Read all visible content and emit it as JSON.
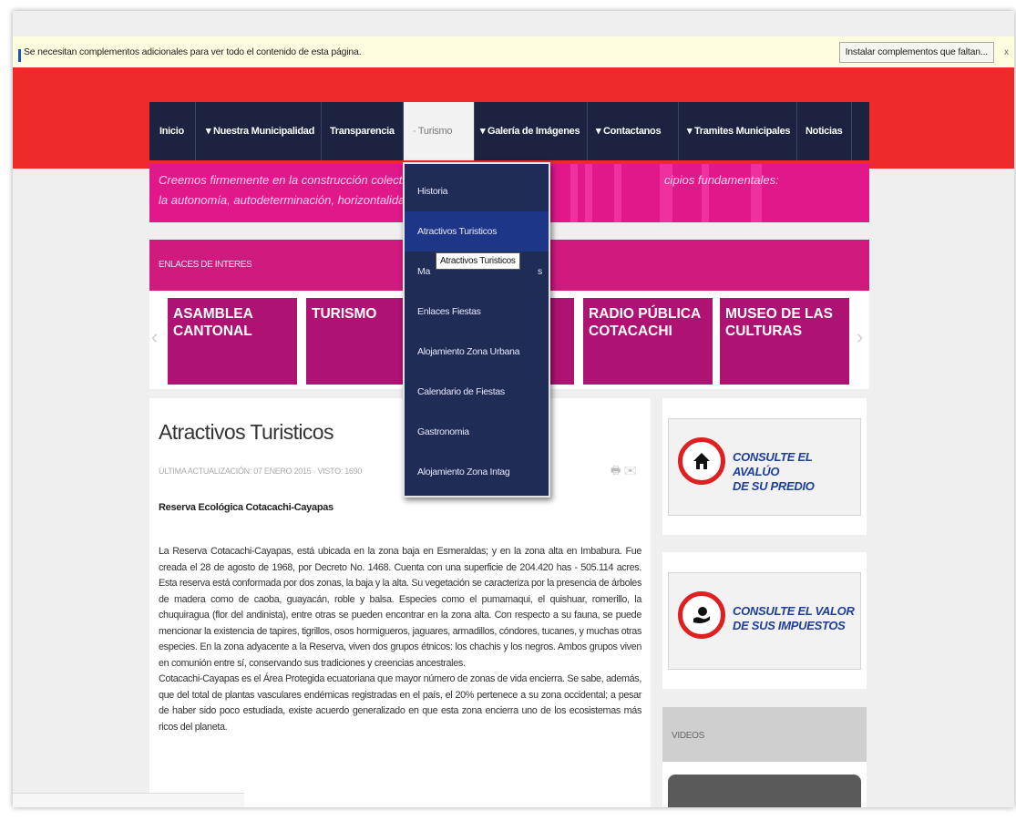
{
  "infobar": {
    "message": "Se necesitan complementos adicionales para ver todo el contenido de esta página.",
    "install_button": "Instalar complementos que faltan...",
    "close": "x"
  },
  "nav": {
    "items": [
      {
        "label": "Inicio"
      },
      {
        "label": "▾ Nuestra Municipalidad"
      },
      {
        "label": "Transparencia"
      },
      {
        "label": "· Turismo"
      },
      {
        "label": "▾ Galería de Imágenes"
      },
      {
        "label": "▾ Contactanos"
      },
      {
        "label": "▾ Tramites Municipales"
      },
      {
        "label": "Noticias"
      }
    ]
  },
  "banner": {
    "line1": "Creemos firmemente en la construcción colectiva",
    "line2": "la autonomía, autodeterminación, horizontalidad",
    "line3": "cipios fundamentales:"
  },
  "links": {
    "heading": "ENLACES DE INTERES",
    "tiles": [
      {
        "label": "ASAMBLEA\nCANTONAL"
      },
      {
        "label": "TURISMO"
      },
      {
        "label": "RADIO PÚBLICA\nCOTACACHI"
      },
      {
        "label": "MUSEO DE LAS\nCULTURAS"
      }
    ],
    "prev": "‹",
    "next": "›"
  },
  "dropdown": {
    "items": [
      {
        "label": "Historia"
      },
      {
        "label": "Atractivos Turisticos"
      },
      {
        "label": "Ma"
      },
      {
        "label": "Enlaces Fiestas"
      },
      {
        "label": "Alojamiento Zona Urbana"
      },
      {
        "label": "Calendario de Fiestas"
      },
      {
        "label": "Gastronomia"
      },
      {
        "label": "Alojamiento Zona Intag"
      }
    ],
    "tooltip": "Atractivos Turisticos",
    "tail": "s"
  },
  "article": {
    "title": "Atractivos Turisticos",
    "meta": "ÚLTIMA ACTUALIZACIÓN: 07 ENERO 2015 · VISTO: 1690",
    "tools": "🖶 ✉",
    "subtitle": "Reserva Ecológica Cotacachi-Cayapas",
    "p1": "La Reserva Cotacachi-Cayapas, está ubicada en la zona baja en Esmeraldas; y en la zona alta en Imbabura. Fue creada el 28 de agosto de 1968, por Decreto No. 1468. Cuenta con una superficie de 204.420 has - 505.114 acres. Esta reserva está conformada por dos zonas, la baja y la alta. Su vegetación se caracteriza por la presencia de árboles de madera como de caoba, guayacán, roble y balsa. Especies como el pumamaqui, el quishuar, romerillo, la chuquiragua (flor del andinista), entre otras se pueden encontrar en la zona alta.  Con respecto a su fauna, se puede mencionar la existencia de tapires, tigrillos, osos hormigueros, jaguares, armadillos, cóndores, tucanes, y muchas otras especies. En la zona adyacente a la Reserva, viven dos grupos étnicos: los chachis y los negros. Ambos grupos viven en comunión entre sí, conservando sus tradiciones y creencias ancestrales.",
    "p2": "Cotacachi-Cayapas es el Área Protegida ecuatoriana que mayor número de zonas de vida encierra. Se sabe, además, que del total de plantas vasculares endémicas registradas en el país, el 20% pertenece a su zona occidental; a pesar de haber sido poco estudiada, existe acuerdo generalizado en que esta zona encierra uno de los ecosistemas más ricos del planeta."
  },
  "sidebar": {
    "card1": "CONSULTE EL AVALÚO\nDE SU PREDIO",
    "card2": "CONSULTE EL VALOR\nDE SUS IMPUESTOS",
    "videos": "VIDEOS"
  }
}
